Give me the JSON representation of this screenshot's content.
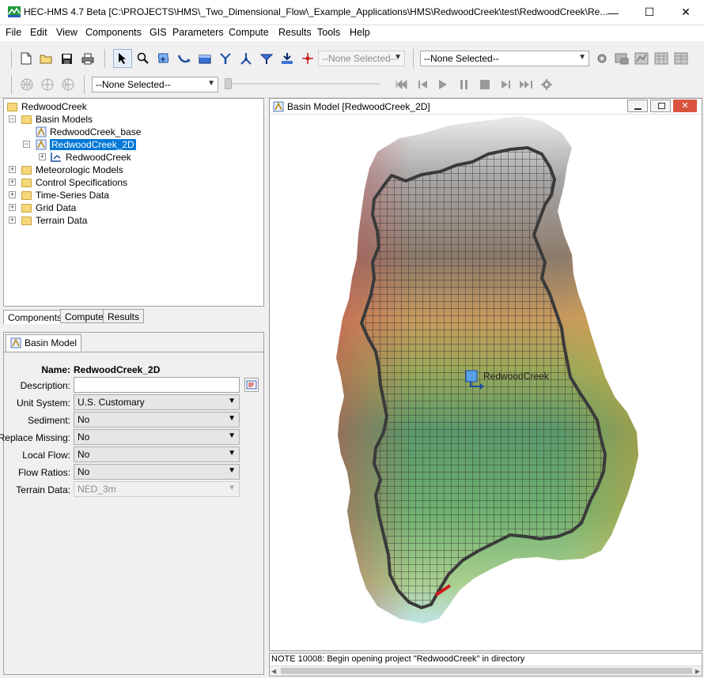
{
  "window": {
    "title": "HEC-HMS 4.7 Beta [C:\\PROJECTS\\HMS\\_Two_Dimensional_Flow\\_Example_Applications\\HMS\\RedwoodCreek\\test\\RedwoodCreek\\Re...",
    "minimize_glyph": "—",
    "maximize_glyph": "☐",
    "close_glyph": "✕"
  },
  "menu": [
    "File",
    "Edit",
    "View",
    "Components",
    "GIS",
    "Parameters",
    "Compute",
    "Results",
    "Tools",
    "Help"
  ],
  "toolbar": {
    "element_select_value": "--None Selected--",
    "run_select_value": "--None Selected--",
    "time_select_value": "--None Selected--"
  },
  "tree": {
    "root": "RedwoodCreek",
    "basin_models_label": "Basin Models",
    "basin_items": [
      "RedwoodCreek_base",
      "RedwoodCreek_2D"
    ],
    "subbasin_item": "RedwoodCreek",
    "other_folders": [
      "Meteorologic Models",
      "Control Specifications",
      "Time-Series Data",
      "Grid Data",
      "Terrain Data"
    ]
  },
  "tabs": [
    "Components",
    "Compute",
    "Results"
  ],
  "properties": {
    "tab_label": "Basin Model",
    "name_label": "Name:",
    "name_value": "RedwoodCreek_2D",
    "description_label": "Description:",
    "description_value": "",
    "rows": [
      {
        "label": "Unit System:",
        "value": "U.S. Customary"
      },
      {
        "label": "Sediment:",
        "value": "No"
      },
      {
        "label": "Replace Missing:",
        "value": "No"
      },
      {
        "label": "Local Flow:",
        "value": "No"
      },
      {
        "label": "Flow Ratios:",
        "value": "No"
      },
      {
        "label": "Terrain Data:",
        "value": "NED_3m"
      }
    ]
  },
  "map": {
    "title": "Basin Model [RedwoodCreek_2D]",
    "element_label": "RedwoodCreek"
  },
  "status": {
    "message": "NOTE 10008:  Begin opening project \"RedwoodCreek\" in directory"
  },
  "colors": {
    "selection": "#0078d7",
    "folder": "#f6d77a",
    "boundary": "#3a3a3a",
    "outlet": "#d11a1a"
  }
}
